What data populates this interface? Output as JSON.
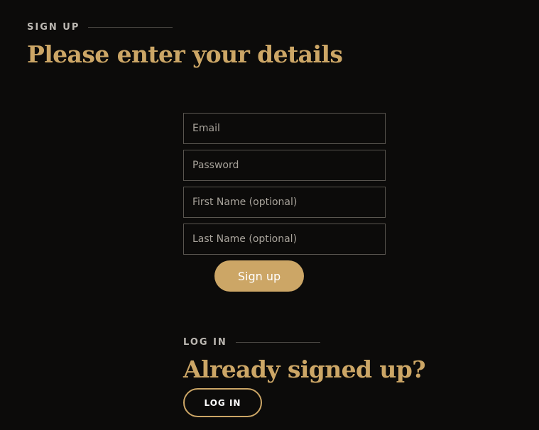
{
  "signup": {
    "eyebrow": "SIGN UP",
    "heading": "Please enter your details",
    "fields": {
      "email_placeholder": "Email",
      "password_placeholder": "Password",
      "first_name_placeholder": "First Name (optional)",
      "last_name_placeholder": "Last Name (optional)"
    },
    "submit_label": "Sign up"
  },
  "login": {
    "eyebrow": "LOG IN",
    "heading": "Already signed up?",
    "button_label": "LOG IN"
  },
  "colors": {
    "background": "#0c0b0a",
    "accent": "#cca666",
    "field_border": "#5a5650",
    "eyebrow_text": "#bdb9b3"
  }
}
